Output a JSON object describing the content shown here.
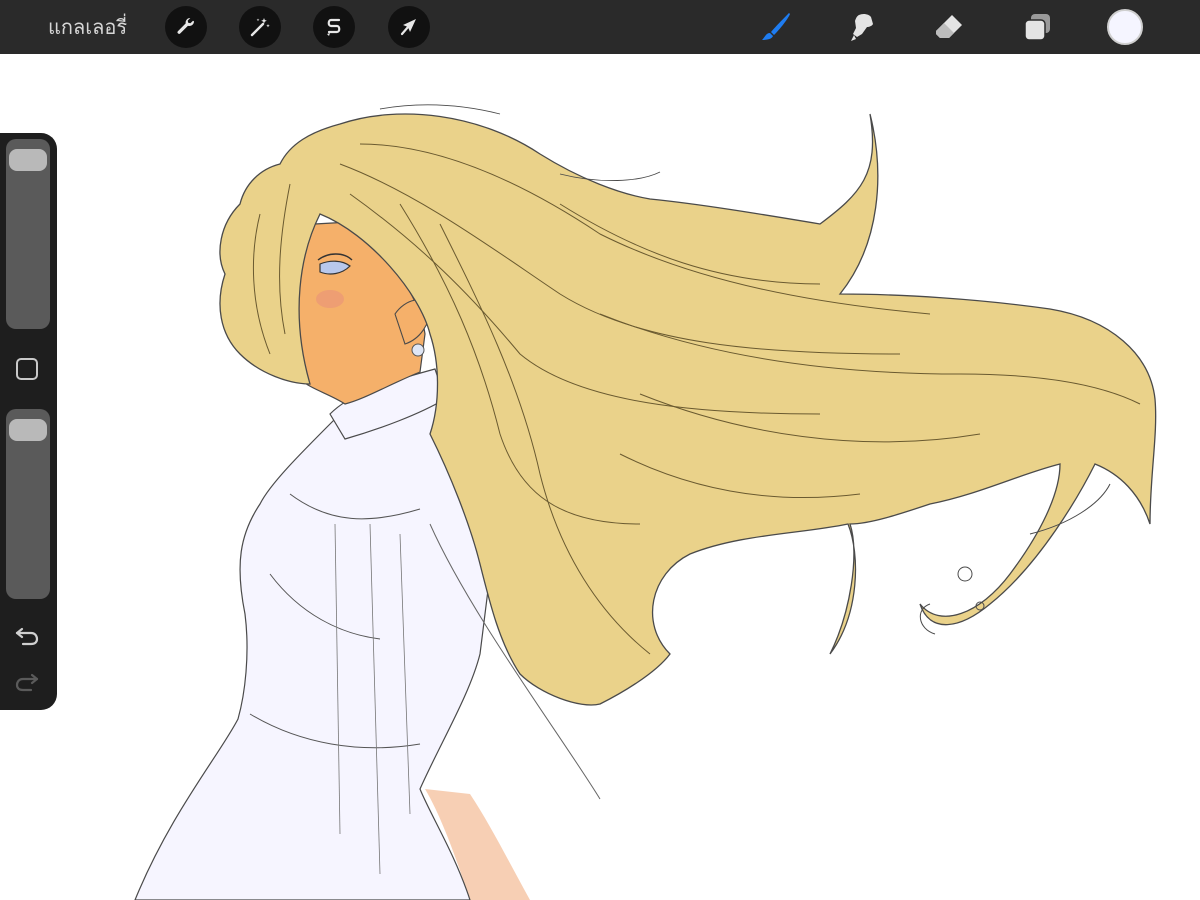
{
  "app": {
    "gallery_label": "แกลเลอรี่"
  },
  "toolbar": {
    "left_tools": [
      {
        "name": "actions",
        "icon": "wrench-icon"
      },
      {
        "name": "adjustments",
        "icon": "magic-wand-icon"
      },
      {
        "name": "selection",
        "icon": "selection-s-icon"
      },
      {
        "name": "transform",
        "icon": "arrow-cursor-icon"
      }
    ],
    "right_tools": [
      {
        "name": "brush",
        "icon": "brush-icon",
        "active": true
      },
      {
        "name": "smudge",
        "icon": "smudge-finger-icon",
        "active": false
      },
      {
        "name": "eraser",
        "icon": "eraser-icon",
        "active": false
      },
      {
        "name": "layers",
        "icon": "layers-icon",
        "active": false
      }
    ],
    "current_color": "#f5f5ff"
  },
  "colors": {
    "toolbar_bg": "#2a2a2a",
    "active_tool": "#1e7cf0",
    "hair_fill": "#ead28a",
    "skin_fill": "#f5b06a",
    "dress_fill": "#f6f5ff",
    "line_art": "#3a3a3a"
  },
  "sidebar": {
    "brush_size_slider": {
      "level": 0.96
    },
    "opacity_slider": {
      "level": 0.96
    },
    "modify_button_icon": "square-icon",
    "undo_icon": "undo-arrow-icon",
    "redo_icon": "redo-arrow-icon"
  }
}
